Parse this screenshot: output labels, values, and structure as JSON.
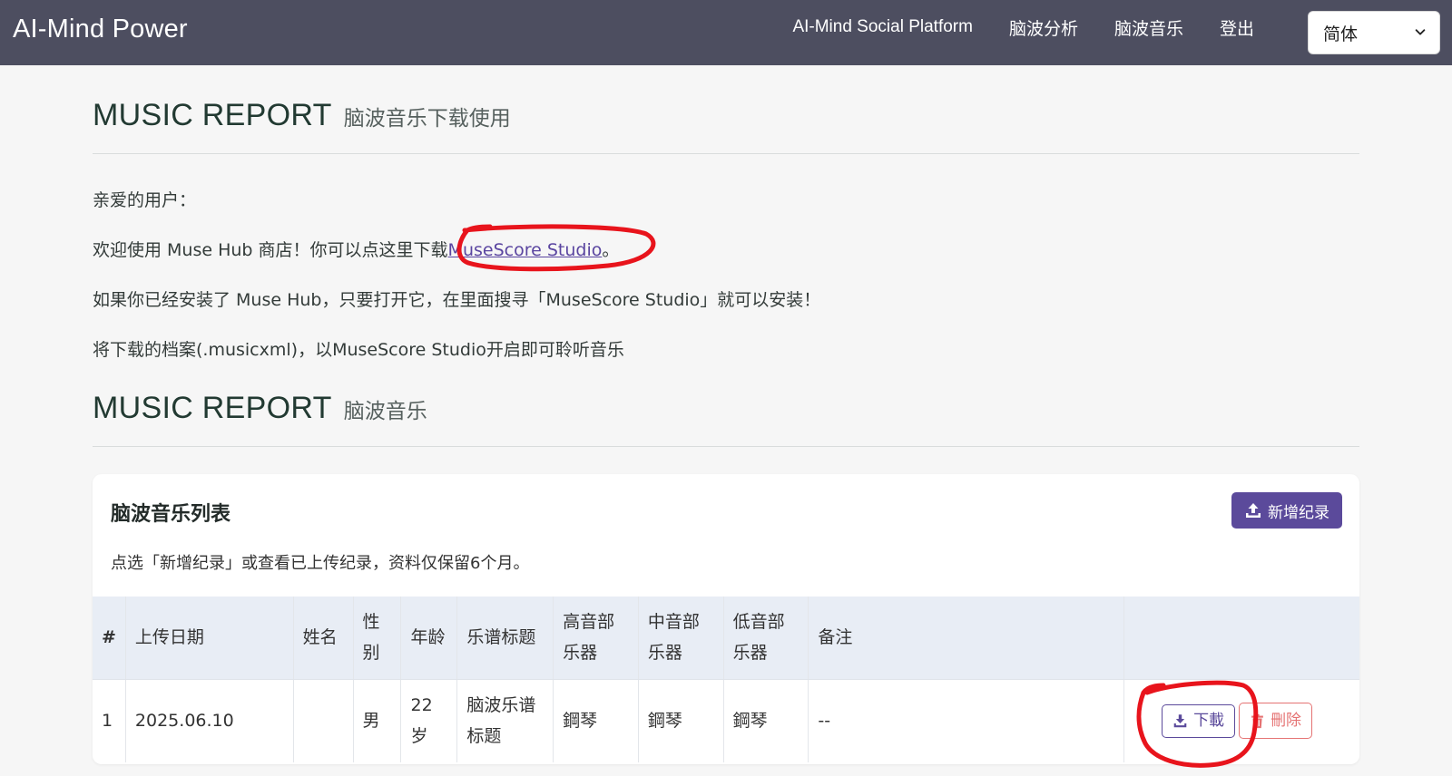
{
  "nav": {
    "brand": "AI-Mind Power",
    "links": [
      "AI-Mind Social Platform",
      "脑波分析",
      "脑波音乐",
      "登出"
    ],
    "language": "简体"
  },
  "section1": {
    "title": "MUSIC REPORT",
    "subtitle": "脑波音乐下载使用",
    "greeting": "亲爱的用户：",
    "line1_before": "欢迎使用 Muse Hub 商店！你可以点这里下载",
    "line1_link": "MuseScore Studio",
    "line1_after": "。",
    "line2": "如果你已经安装了 Muse Hub，只要打开它，在里面搜寻「MuseScore Studio」就可以安装！",
    "line3": "将下载的档案(.musicxml)，以MuseScore Studio开启即可聆听音乐"
  },
  "section2": {
    "title": "MUSIC REPORT",
    "subtitle": "脑波音乐"
  },
  "card": {
    "title": "脑波音乐列表",
    "add_label": "新增纪录",
    "description": "点选「新增纪录」或查看已上传纪录，资料仅保留6个月。",
    "headers": [
      "#",
      "上传日期",
      "姓名",
      "性别",
      "年龄",
      "乐谱标题",
      "高音部乐器",
      "中音部乐器",
      "低音部乐器",
      "备注",
      ""
    ],
    "rows": [
      {
        "num": "1",
        "date": "2025.06.10",
        "name": "",
        "gender": "男",
        "age": "22岁",
        "score_title": "脑波乐谱标题",
        "treble": "鋼琴",
        "alto": "鋼琴",
        "bass": "鋼琴",
        "note": "--",
        "download_label": "下載",
        "delete_label": "刪除"
      }
    ]
  },
  "colors": {
    "navbar": "#4d4e60",
    "accent": "#5b4a9b",
    "danger": "#e57373",
    "annotation": "#e8141c"
  }
}
